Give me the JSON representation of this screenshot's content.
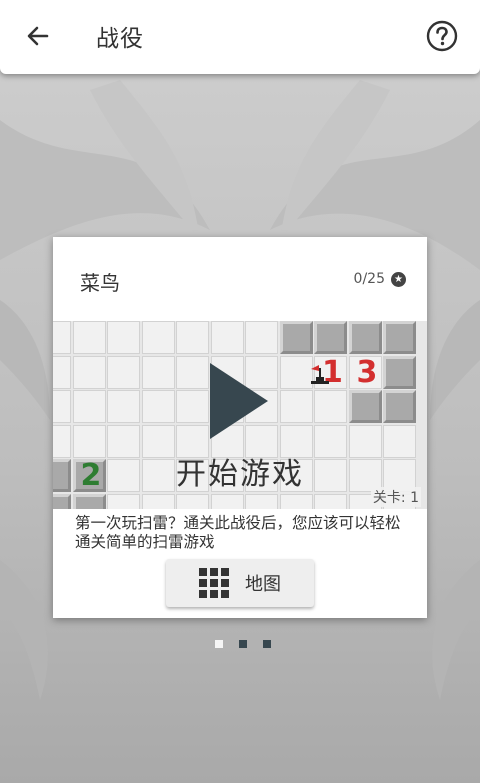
{
  "header": {
    "title": "战役",
    "back_icon": "arrow-left-icon",
    "help_icon": "help-circle-icon"
  },
  "card": {
    "difficulty": "菜鸟",
    "progress": "0/25",
    "progress_icon": "star-icon",
    "board": {
      "play_icon": "play-icon",
      "start_label": "开始游戏",
      "level_label": "关卡: 1",
      "numbers": [
        {
          "value": "1",
          "color": "#d32f2f"
        },
        {
          "value": "3",
          "color": "#d32f2f"
        },
        {
          "value": "2",
          "color": "#2e7d32"
        }
      ],
      "flag_icon": "mine-flag-icon"
    },
    "description": "第一次玩扫雷？通关此战役后，您应该可以轻松通关简单的扫雷游戏",
    "map_button": {
      "label": "地图",
      "icon": "grid-icon"
    }
  },
  "pager": {
    "pages": 3,
    "active": 0
  }
}
